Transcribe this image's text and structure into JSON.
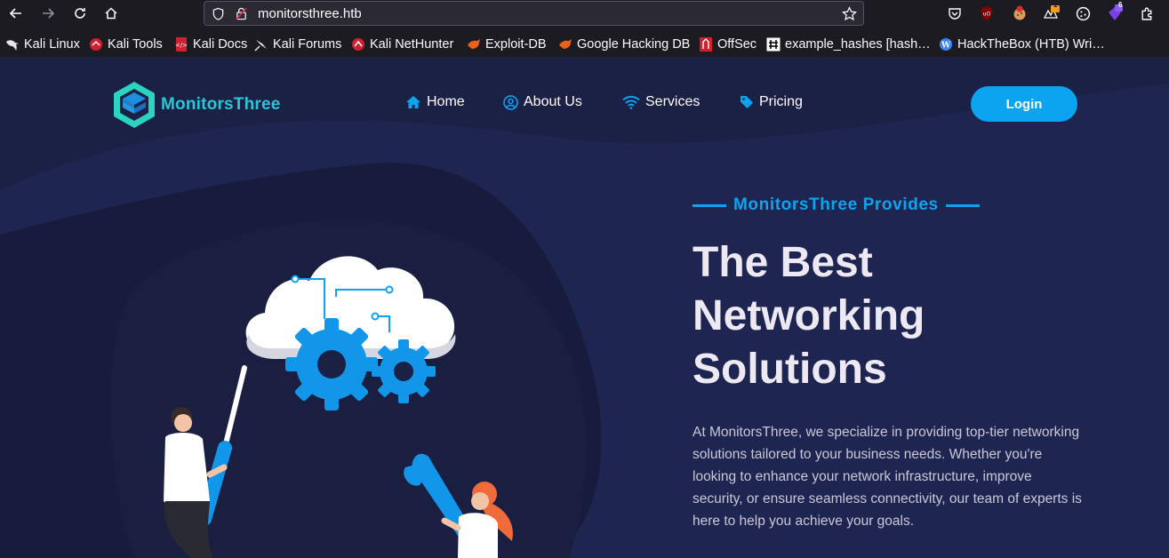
{
  "browser": {
    "url": "monitorsthree.htb",
    "bookmarks": [
      {
        "label": "Kali Linux",
        "icon": "kali-dragon-icon"
      },
      {
        "label": "Kali Tools",
        "icon": "kali-tools-icon"
      },
      {
        "label": "Kali Docs",
        "icon": "kali-docs-icon"
      },
      {
        "label": "Kali Forums",
        "icon": "kali-forums-icon"
      },
      {
        "label": "Kali NetHunter",
        "icon": "kali-nethunter-icon"
      },
      {
        "label": "Exploit-DB",
        "icon": "exploit-db-icon"
      },
      {
        "label": "Google Hacking DB",
        "icon": "ghdb-icon"
      },
      {
        "label": "OffSec",
        "icon": "offsec-icon"
      },
      {
        "label": "example_hashes [hash…",
        "icon": "hashcat-icon"
      },
      {
        "label": "HackTheBox (HTB) Wri…",
        "icon": "wordpress-icon"
      }
    ],
    "extension_badges": {
      "notes": "1",
      "extension": "6"
    }
  },
  "site": {
    "brand": "MonitorsThree",
    "nav": {
      "home": "Home",
      "about": "About Us",
      "services": "Services",
      "pricing": "Pricing"
    },
    "login_label": "Login"
  },
  "hero": {
    "eyebrow": "MonitorsThree Provides",
    "headline_lines": [
      "The Best",
      "Networking",
      "Solutions"
    ],
    "description": "At MonitorsThree, we specialize in providing top-tier networking solutions tailored to your business needs. Whether you're looking to enhance your network infrastructure, improve security, or ensure seamless connectivity, our team of experts is here to help you achieve your goals."
  },
  "colors": {
    "page_bg": "#1b2045",
    "accent": "#0ba4f0",
    "brand_text": "#29c7d6",
    "headline": "#ece9f2"
  }
}
